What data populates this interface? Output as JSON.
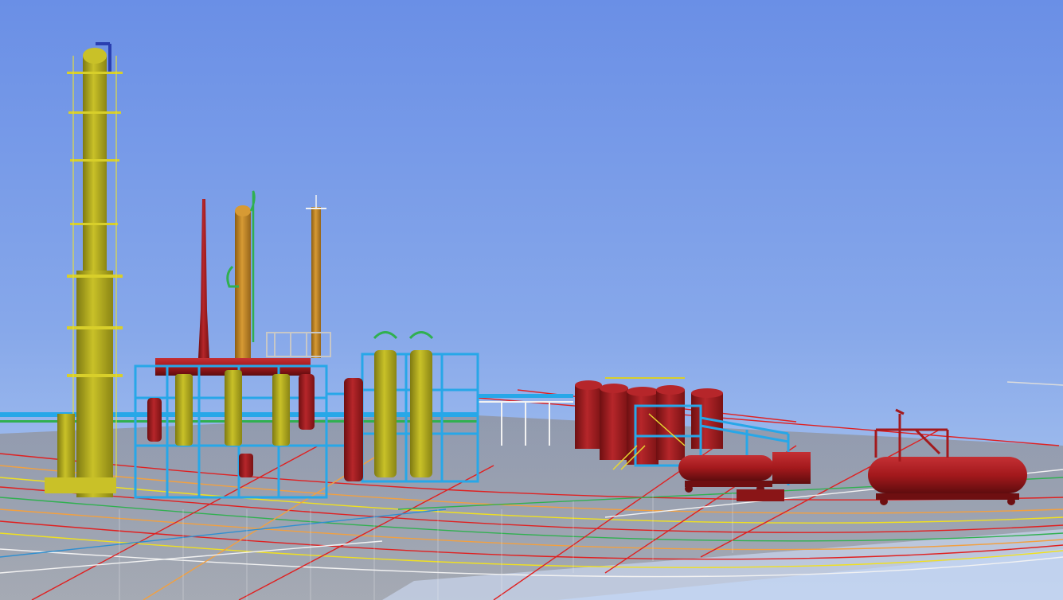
{
  "viewport": {
    "sky_top_color": "#6a8fe6",
    "sky_bottom_color": "#a9c4ee",
    "ground_color": "#b9c8e6",
    "deck_color": "#8f857a",
    "palette": {
      "column_yellow": "#b9b11f",
      "column_yellow_dark": "#7e7a12",
      "orange_column": "#c98e2a",
      "structure_blue": "#27a7e8",
      "vessel_red": "#a3191c",
      "vessel_red_dark": "#6e0f11",
      "pipe_red": "#e02020",
      "pipe_orange": "#f2a040",
      "pipe_yellow": "#f0e020",
      "pipe_green": "#30b050",
      "pipe_white": "#f2f2f2"
    }
  }
}
